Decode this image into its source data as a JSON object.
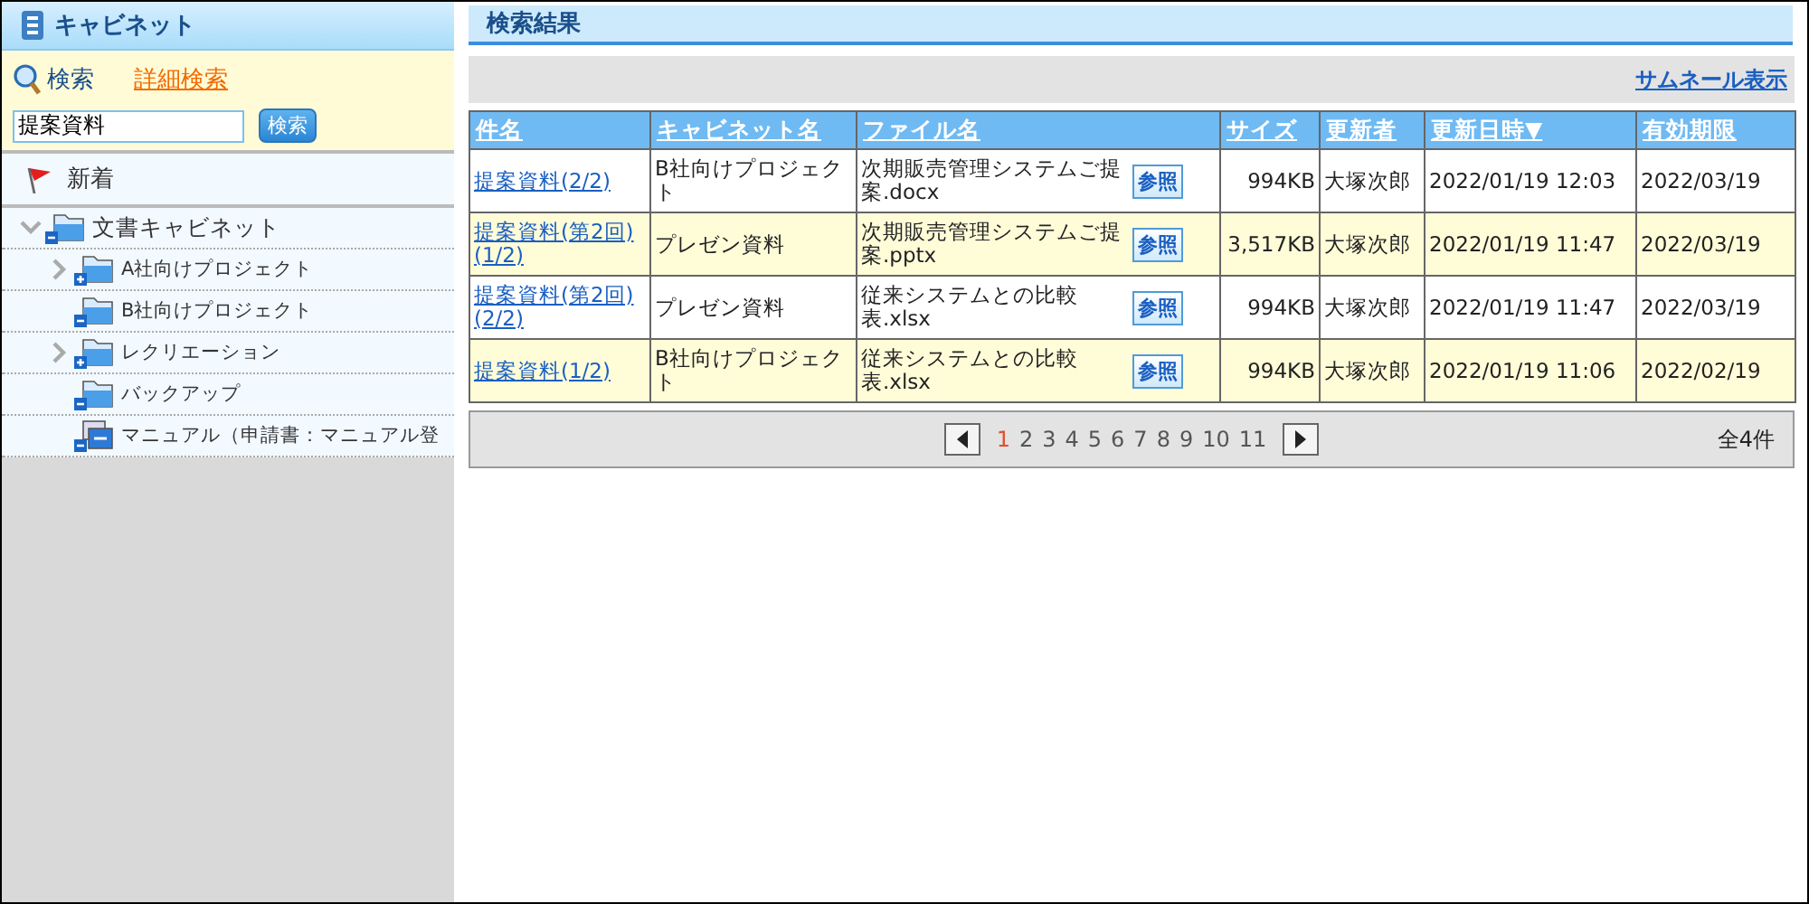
{
  "sidebar": {
    "title": "キャビネット",
    "search_links": [
      {
        "label": "検索",
        "kind": "plain"
      },
      {
        "label": "詳細検索",
        "kind": "link"
      }
    ],
    "search_field": {
      "value": "提案資料"
    },
    "search_button": "検索",
    "new_item": "新着",
    "tree": [
      {
        "label": "文書キャビネット",
        "kind": "folder",
        "expanded": true,
        "children": [
          {
            "label": "A社向けプロジェクト",
            "kind": "folder",
            "expanded": false
          },
          {
            "label": "B社向けプロジェクト",
            "kind": "folder",
            "expanded": true
          },
          {
            "label": "レクリエーション",
            "kind": "folder",
            "expanded": false
          },
          {
            "label": "バックアップ",
            "kind": "folder",
            "expanded": true
          },
          {
            "label": "マニュアル（申請書：マニュアル登",
            "kind": "shortcut",
            "expanded": true
          }
        ]
      }
    ]
  },
  "main": {
    "title": "検索結果",
    "thumbnail_link": "サムネール表示",
    "table": {
      "columns": [
        "件名",
        "キャビネット名",
        "ファイル名",
        "サイズ",
        "更新者",
        "更新日時▼",
        "有効期限"
      ],
      "rows": [
        {
          "subject": "提案資料(2/2)",
          "cabinet": "B社向けプロジェクト",
          "file": "次期販売管理システムご提案.docx",
          "button": "参照",
          "size": "994KB",
          "updater": "大塚次郎",
          "updated": "2022/01/19 12:03",
          "expires": "2022/03/19"
        },
        {
          "subject": "提案資料(第2回)(1/2)",
          "cabinet": "プレゼン資料",
          "file": "次期販売管理システムご提案.pptx",
          "button": "参照",
          "size": "3,517KB",
          "updater": "大塚次郎",
          "updated": "2022/01/19 11:47",
          "expires": "2022/03/19"
        },
        {
          "subject": "提案資料(第2回)(2/2)",
          "cabinet": "プレゼン資料",
          "file": "従来システムとの比較表.xlsx",
          "button": "参照",
          "size": "994KB",
          "updater": "大塚次郎",
          "updated": "2022/01/19 11:47",
          "expires": "2022/03/19"
        },
        {
          "subject": "提案資料(1/2)",
          "cabinet": "B社向けプロジェクト",
          "file": "従来システムとの比較表.xlsx",
          "button": "参照",
          "size": "994KB",
          "updater": "大塚次郎",
          "updated": "2022/01/19 11:06",
          "expires": "2022/02/19"
        }
      ]
    },
    "pagination": {
      "pages": [
        {
          "label": "1",
          "selected": true
        },
        {
          "label": "2",
          "selected": false
        },
        {
          "label": "3",
          "selected": false
        },
        {
          "label": "4",
          "selected": false
        },
        {
          "label": "5",
          "selected": false
        },
        {
          "label": "6",
          "selected": false
        },
        {
          "label": "7",
          "selected": false
        },
        {
          "label": "8",
          "selected": false
        },
        {
          "label": "9",
          "selected": false
        },
        {
          "label": "10",
          "selected": false
        },
        {
          "label": "11",
          "selected": false
        }
      ],
      "total": "全4件"
    }
  }
}
